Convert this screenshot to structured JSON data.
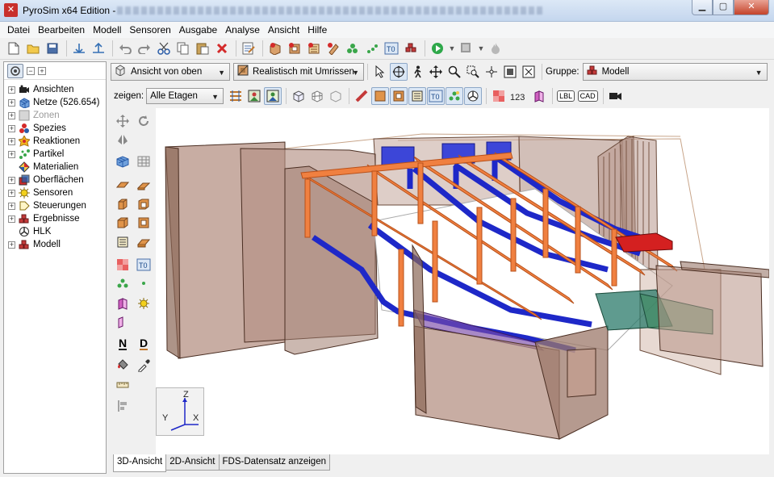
{
  "window": {
    "title": "PyroSim x64 Edition -",
    "minimize": "▁",
    "maximize": "▢",
    "close": "✕"
  },
  "menu": [
    "Datei",
    "Bearbeiten",
    "Modell",
    "Sensoren",
    "Ausgabe",
    "Analyse",
    "Ansicht",
    "Hilfe"
  ],
  "tree": [
    {
      "label": "Ansichten",
      "icon": "camera-icon",
      "expandable": true
    },
    {
      "label": "Netze (526.654)",
      "icon": "mesh-icon",
      "expandable": true
    },
    {
      "label": "Zonen",
      "icon": "zone-icon",
      "expandable": true,
      "disabled": true
    },
    {
      "label": "Spezies",
      "icon": "species-icon",
      "expandable": true
    },
    {
      "label": "Reaktionen",
      "icon": "reaction-icon",
      "expandable": true
    },
    {
      "label": "Partikel",
      "icon": "particle-icon",
      "expandable": true
    },
    {
      "label": "Materialien",
      "icon": "material-icon",
      "expandable": false
    },
    {
      "label": "Oberflächen",
      "icon": "surface-icon",
      "expandable": true
    },
    {
      "label": "Sensoren",
      "icon": "sensor-icon",
      "expandable": true
    },
    {
      "label": "Steuerungen",
      "icon": "control-icon",
      "expandable": true
    },
    {
      "label": "Ergebnisse",
      "icon": "results-icon",
      "expandable": true
    },
    {
      "label": "HLK",
      "icon": "hvac-icon",
      "expandable": false
    },
    {
      "label": "Modell",
      "icon": "model-icon",
      "expandable": true
    }
  ],
  "view_combo": {
    "label": "Ansicht von oben"
  },
  "render_combo": {
    "label": "Realistisch mit Umrissen"
  },
  "group": {
    "label": "Gruppe:",
    "value": "Modell"
  },
  "floor": {
    "label": "zeigen:",
    "value": "Alle Etagen"
  },
  "toolbar3_text": {
    "lbl": "LBL",
    "cad": "CAD",
    "t0": "T0",
    "n123": "123"
  },
  "palette_text": {
    "t0": "T0",
    "n": "N",
    "d": "D"
  },
  "axes": {
    "z": "Z",
    "y": "Y",
    "x": "X"
  },
  "tabs": [
    "3D-Ansicht",
    "2D-Ansicht",
    "FDS-Datensatz anzeigen"
  ],
  "active_tab": 0
}
